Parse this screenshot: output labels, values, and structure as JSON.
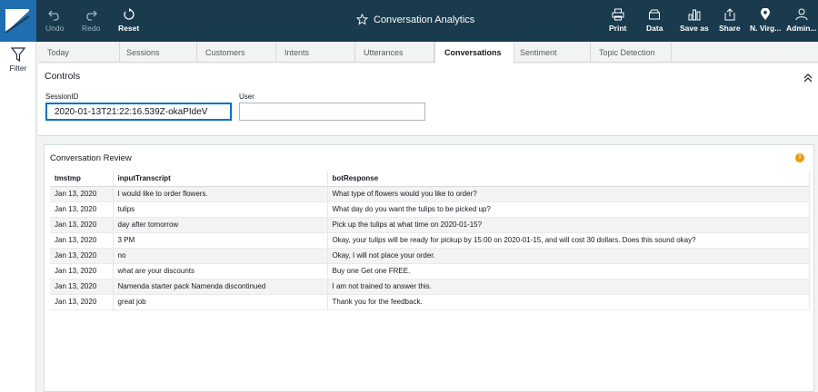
{
  "app": {
    "title": "Conversation Analytics"
  },
  "toolbar": {
    "undo": "Undo",
    "redo": "Redo",
    "reset": "Reset",
    "print": "Print",
    "data": "Data",
    "save_as": "Save as",
    "share": "Share",
    "region": "N. Virg...",
    "admin": "Admin..."
  },
  "left_rail": {
    "filter": "Filter"
  },
  "tabs": [
    "Today",
    "Sessions",
    "Customers",
    "Intents",
    "Utterances",
    "Conversations",
    "Sentiment",
    "Topic Detection"
  ],
  "active_tab": "Conversations",
  "controls": {
    "title": "Controls",
    "session_label": "SessionID",
    "session_value": "2020-01-13T21:22:16.539Z-okaPIdeV",
    "user_label": "User",
    "user_value": ""
  },
  "review": {
    "title": "Conversation Review",
    "columns": [
      "tmstmp",
      "inputTranscript",
      "botResponse"
    ],
    "rows": [
      [
        "Jan 13, 2020",
        "I would like to order flowers.",
        "What type of flowers would you like to order?"
      ],
      [
        "Jan 13, 2020",
        "tulips",
        "What day do you want the tulips to be picked up?"
      ],
      [
        "Jan 13, 2020",
        "day after tomorrow",
        "Pick up the tulips at what time on 2020-01-15?"
      ],
      [
        "Jan 13, 2020",
        "3 PM",
        "Okay, your tulips will be ready for pickup by 15:00 on 2020-01-15, and will cost 30 dollars. Does this sound okay?"
      ],
      [
        "Jan 13, 2020",
        "no",
        "Okay, I will not place your order."
      ],
      [
        "Jan 13, 2020",
        "what are your discounts",
        "Buy one Get one FREE."
      ],
      [
        "Jan 13, 2020",
        "Namenda starter pack Namenda discontinued",
        "I am not trained to answer this."
      ],
      [
        "Jan 13, 2020",
        "great job",
        "Thank you for the feedback."
      ]
    ]
  },
  "colors": {
    "topbar": "#1a3a4e",
    "accent": "#0073bb",
    "warning": "#eb9d07"
  }
}
